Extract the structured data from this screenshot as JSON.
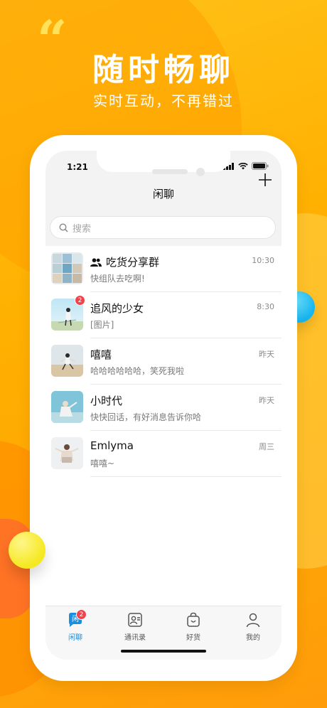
{
  "promo": {
    "quote_mark": "“",
    "headline": "随时畅聊",
    "subline": "实时互动，不再错过"
  },
  "status": {
    "time": "1:21"
  },
  "nav": {
    "title": "闲聊"
  },
  "search": {
    "placeholder": "搜索"
  },
  "chats": [
    {
      "name": "吃货分享群",
      "message": "快组队去吃啊!",
      "time": "10:30",
      "is_group": true
    },
    {
      "name": "追风的少女",
      "message": "[图片]",
      "time": "8:30",
      "badge": "2"
    },
    {
      "name": "嘻嘻",
      "message": "哈哈哈哈哈哈，笑死我啦",
      "time": "昨天"
    },
    {
      "name": "小时代",
      "message": "快快回话，有好消息告诉你哈",
      "time": "昨天"
    },
    {
      "name": "Emlyma",
      "message": "嘻嘻~",
      "time": "周三"
    }
  ],
  "tabs": [
    {
      "label": "闲聊",
      "badge": "2",
      "icon_text": "闲"
    },
    {
      "label": "通讯录"
    },
    {
      "label": "好货"
    },
    {
      "label": "我的"
    }
  ],
  "colors": {
    "accent": "#1C8FDC",
    "badge": "#F2434B",
    "background": "#FFB400"
  }
}
